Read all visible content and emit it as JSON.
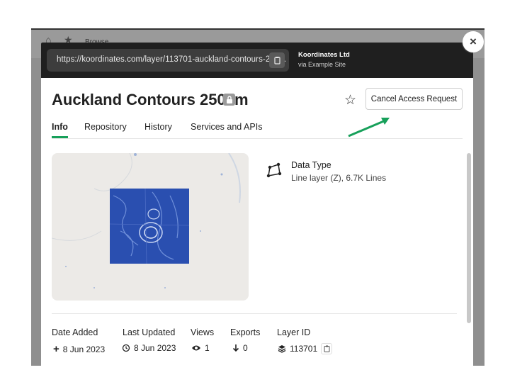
{
  "background": {
    "label": "Browse"
  },
  "topbar": {
    "url": "https://koordinates.com/layer/113701-auckland-contours-250...",
    "org_name": "Koordinates Ltd",
    "org_sub": "via Example Site"
  },
  "header": {
    "title": "Auckland Contours 250cm",
    "cancel_label": "Cancel Access Request"
  },
  "tabs": [
    {
      "label": "Info"
    },
    {
      "label": "Repository"
    },
    {
      "label": "History"
    },
    {
      "label": "Services and APIs"
    }
  ],
  "data_type": {
    "label": "Data Type",
    "value": "Line layer (Z), 6.7K Lines"
  },
  "meta": {
    "date_added": {
      "label": "Date Added",
      "value": "8 Jun 2023"
    },
    "last_updated": {
      "label": "Last Updated",
      "value": "8 Jun 2023"
    },
    "views": {
      "label": "Views",
      "value": "1"
    },
    "exports": {
      "label": "Exports",
      "value": "0"
    },
    "layer_id": {
      "label": "Layer ID",
      "value": "113701"
    }
  },
  "colors": {
    "accent": "#17a05a",
    "contours": "#2a4fb0",
    "topbar": "#1f1f1f"
  },
  "close_symbol": "×"
}
